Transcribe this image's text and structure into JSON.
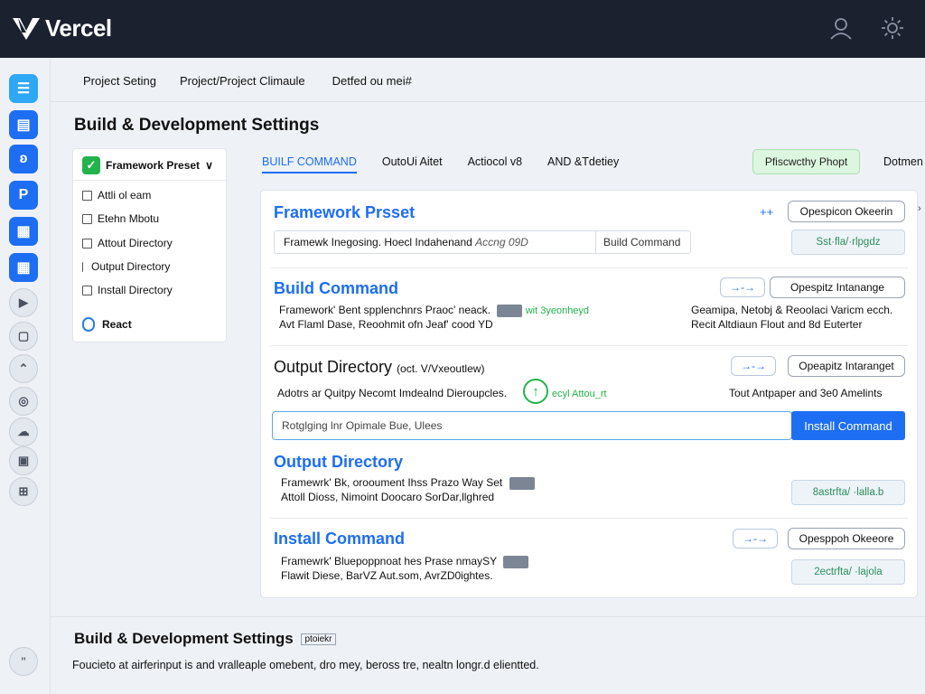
{
  "app": {
    "name": "Vercel"
  },
  "header": {
    "icons": [
      "user-icon",
      "settings-gear-icon"
    ]
  },
  "sidebar": {
    "icons": [
      "list-icon",
      "file-icon",
      "butterfly-icon",
      "p-icon",
      "grid-icon",
      "table-icon",
      "play-icon",
      "box-icon",
      "chevron-icon",
      "globe-icon",
      "cloud-icon",
      "square-icon",
      "grid-small-icon"
    ],
    "bottom_label": "\""
  },
  "nav_tabs": [
    "Project Seting",
    "Project/Project Climaule",
    "Detfed ou mei#"
  ],
  "page_title": "Build & Development Settings",
  "left_panel": {
    "header": "Framework Preset",
    "chevron": "∨",
    "items": [
      "Attli ol eam",
      "Etehn Mbotu",
      "Attout Directory",
      "Output Directory",
      "Install Directory"
    ],
    "framework": "React"
  },
  "sub_tabs": [
    "BUILF COMMAND",
    "OutoUi Aitet",
    "Actiocol v8",
    "AND &Tdetiey"
  ],
  "preview_button": "Pfiscwcthy Phopt",
  "right_link": "Dotmen",
  "sections": {
    "framework_preset": {
      "title": "Framework Prsset",
      "plus": "++",
      "button": "Opespicon Okeerin",
      "input_value": "Framewk Inegosing. Hoecl Indahenand",
      "input_hint": "Accng 09D",
      "input_addon": "Build Command",
      "pale_button": "Sst·fla/·rlpgdz"
    },
    "build_command": {
      "title": "Build Command",
      "line1": "Framework' Bent spplenchnrs Praoc' neack.",
      "line1_note": "wit 3yeonheyd",
      "line2": "Avt Flaml Dase, Reoohmit ofn Jeaf' cood YD",
      "arrow": "→-→",
      "button": "Opespitz Intanange",
      "right_line1": "Geamipa, Netobj & Reoolaci Varicm ecch.",
      "right_line2": "Recit Altdiaun Flout and 8d Euterter"
    },
    "output_directory_top": {
      "title": "Output  Directory",
      "title_suffix": "(oct. V/Vxeoutlew)",
      "line1": "Adotrs ar Quitpy Necomt Imdealnd Dieroupcles.",
      "line1_note": "ecyl Attou_rt",
      "arrow": "→-→",
      "button": "Opeapitz Intaranget",
      "right_line": "Tout Antpaper and 3e0 Amelints",
      "install_input": "Rotglging lnr  Opimale Bue,  Ulees",
      "install_button": "Install Command"
    },
    "output_directory": {
      "title": "Output Directory",
      "line1": "Framewrk' Bk, orooument Ihss Prazo Way Set",
      "line2": "Attoll Dioss, Nimoint Doocaro SorDar,llghred",
      "pale_button": "8astrfta/ ·lalla.b"
    },
    "install_command": {
      "title": "Install Command",
      "line1": "Framewrk' Bluepoppnoat hes Prase nmaySY",
      "line2": "Flawit Diese, BarVZ Aut.som, AvrZD0ightes.",
      "arrow": "→-→",
      "button": "Opesppoh Okeeore",
      "pale_button": "2ectrfta/ ·lajola"
    }
  },
  "footer": {
    "title": "Build & Development Settings",
    "badge": "ptoiekr",
    "description": "Foucieto at airferinput is and vralleaple omebent, dro mey, beross tre, nealtn longr.d elientted."
  },
  "colors": {
    "topbar": "#1c2130",
    "accent_blue": "#1d6ef2",
    "accent_green": "#22b34a",
    "background": "#eef1f6"
  }
}
